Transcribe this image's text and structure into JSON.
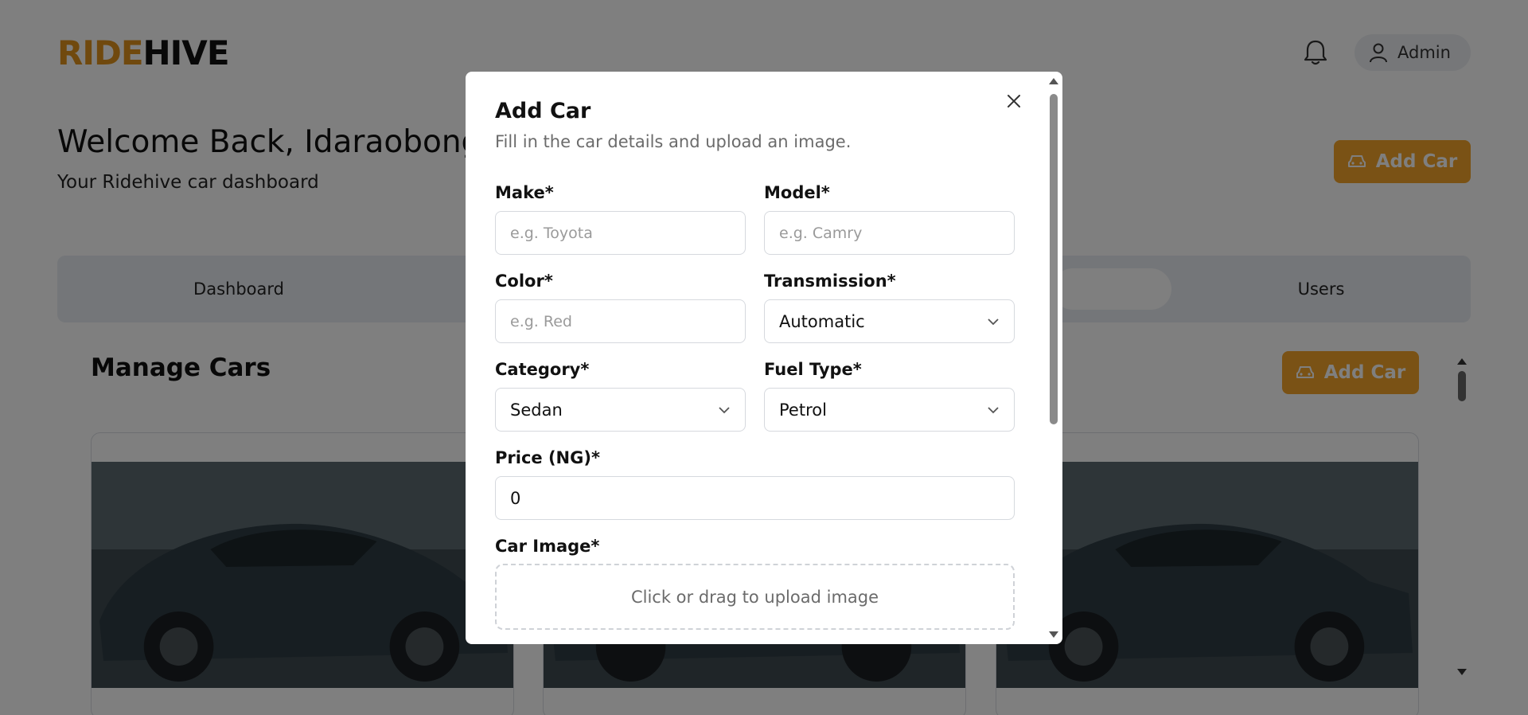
{
  "brand": {
    "part1": "RIDE",
    "part2": "HIVE",
    "accent": "#e0921c"
  },
  "header": {
    "user_label": "Admin",
    "bell_icon": "bell-icon",
    "user_icon": "user-icon"
  },
  "welcome": {
    "title": "Welcome Back, Idaraobong!",
    "subtitle": "Your Ridehive car dashboard"
  },
  "actions": {
    "add_car_label": "Add Car",
    "add_car_icon": "car-icon"
  },
  "tabs": [
    {
      "label": "Dashboard"
    },
    {
      "label": "Users"
    }
  ],
  "section": {
    "title": "Manage Cars",
    "add_car_label": "Add Car"
  },
  "modal": {
    "title": "Add Car",
    "description": "Fill in the car details and upload an image.",
    "fields": {
      "make": {
        "label": "Make*",
        "placeholder": "e.g. Toyota"
      },
      "model": {
        "label": "Model*",
        "placeholder": "e.g. Camry"
      },
      "color": {
        "label": "Color*",
        "placeholder": "e.g. Red"
      },
      "transmission": {
        "label": "Transmission*",
        "value": "Automatic"
      },
      "category": {
        "label": "Category*",
        "value": "Sedan"
      },
      "fuel_type": {
        "label": "Fuel Type*",
        "value": "Petrol"
      },
      "price": {
        "label": "Price (NG)*",
        "value": "0"
      },
      "image": {
        "label": "Car Image*",
        "upload_text": "Click or drag to upload image"
      }
    }
  }
}
